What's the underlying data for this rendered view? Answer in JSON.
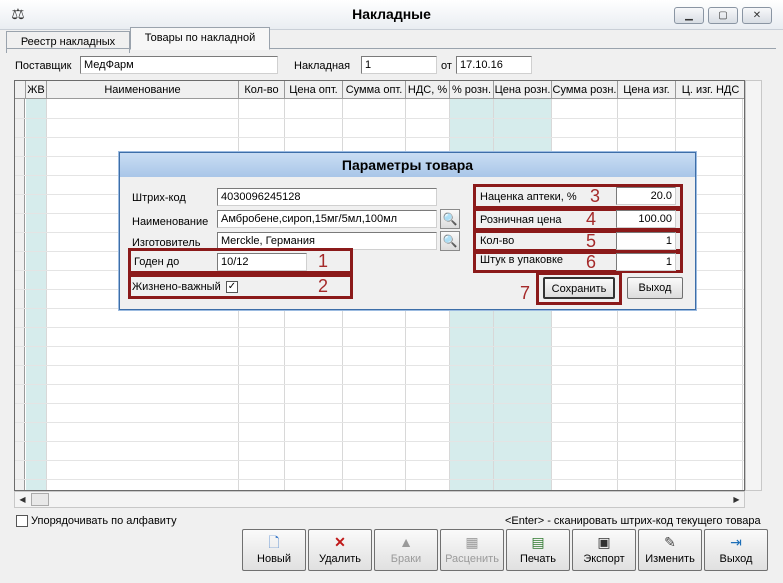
{
  "window": {
    "title": "Накладные",
    "app_icon": "scales-icon"
  },
  "tabs": [
    {
      "label": "Реестр накладных"
    },
    {
      "label": "Товары по накладной"
    }
  ],
  "header": {
    "supplier_label": "Поставщик",
    "supplier_value": "МедФарм",
    "invoice_label": "Накладная",
    "invoice_value": "1",
    "from_label": "от",
    "date_value": "17.10.16"
  },
  "grid": {
    "columns": [
      "ЖВ",
      "Наименование",
      "Кол-во",
      "Цена опт.",
      "Сумма опт.",
      "НДС, %",
      "% розн.",
      "Цена розн.",
      "Сумма розн.",
      "Цена изг.",
      "Ц. изг. НДС"
    ]
  },
  "dialog": {
    "title": "Параметры товара",
    "barcode_label": "Штрих-код",
    "barcode_value": "4030096245128",
    "name_label": "Наименование",
    "name_value": "Амбробене,сироп,15мг/5мл,100мл",
    "maker_label": "Изготовитель",
    "maker_value": "Merckle, Германия",
    "expiry_label": "Годен до",
    "expiry_value": "10/12",
    "vital_label": "Жизнено-важный",
    "vital_checked": true,
    "markup_label": "Наценка аптеки, %",
    "markup_value": "20.0",
    "retail_label": "Розничная цена",
    "retail_value": "100.00",
    "qty_label": "Кол-во",
    "qty_value": "1",
    "pack_label": "Штук в упаковке",
    "pack_value": "1",
    "save_label": "Сохранить",
    "exit_label": "Выход"
  },
  "annotations": [
    "1",
    "2",
    "3",
    "4",
    "5",
    "6",
    "7"
  ],
  "footer": {
    "sort_label": "Упорядочивать по алфавиту",
    "hint": "<Enter> - сканировать штрих-код текущего товара"
  },
  "toolbar": {
    "new": "Новый",
    "delete": "Удалить",
    "defects": "Браки",
    "split": "Расценить",
    "print": "Печать",
    "export": "Экспорт",
    "edit": "Изменить",
    "exit": "Выход"
  },
  "colors": {
    "highlight_column": "#d6ecec",
    "annotation": "#8b1a1a",
    "dialog_title": "#b8d1ee"
  }
}
